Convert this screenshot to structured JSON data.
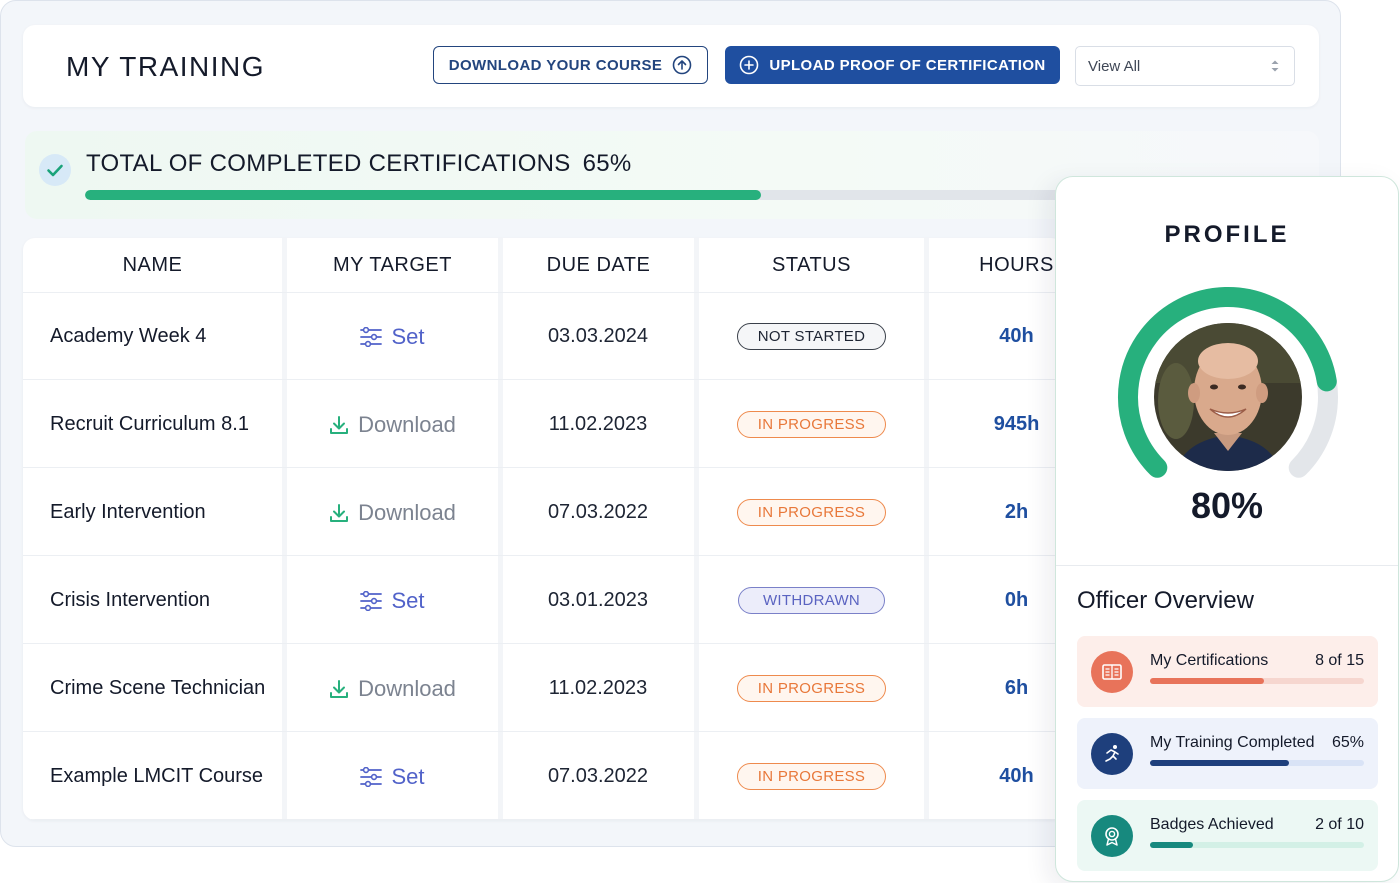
{
  "header": {
    "title": "MY TRAINING",
    "download_label": "DOWNLOAD YOUR COURSE",
    "upload_label": "UPLOAD PROOF OF CERTIFICATION",
    "filter_value": "View All"
  },
  "progress": {
    "title": "TOTAL OF COMPLETED CERTIFICATIONS",
    "percent_text": "65%",
    "percent": 65,
    "fill_color": "#27b07d"
  },
  "table": {
    "columns": [
      "NAME",
      "MY TARGET",
      "DUE DATE",
      "STATUS",
      "HOURS"
    ],
    "rows": [
      {
        "name": "Academy Week 4",
        "target": "Set",
        "target_type": "set",
        "due": "03.03.2024",
        "status": "NOT STARTED",
        "status_type": "ns",
        "hours": "40h"
      },
      {
        "name": "Recruit Curriculum 8.1",
        "target": "Download",
        "target_type": "dl",
        "due": "11.02.2023",
        "status": "IN PROGRESS",
        "status_type": "ip",
        "hours": "945h"
      },
      {
        "name": "Early Intervention",
        "target": "Download",
        "target_type": "dl",
        "due": "07.03.2022",
        "status": "IN PROGRESS",
        "status_type": "ip",
        "hours": "2h"
      },
      {
        "name": "Crisis Intervention",
        "target": "Set",
        "target_type": "set",
        "due": "03.01.2023",
        "status": "WITHDRAWN",
        "status_type": "wd",
        "hours": "0h"
      },
      {
        "name": "Crime Scene Technician",
        "target": "Download",
        "target_type": "dl",
        "due": "11.02.2023",
        "status": "IN PROGRESS",
        "status_type": "ip",
        "hours": "6h"
      },
      {
        "name": "Example LMCIT Course",
        "target": "Set",
        "target_type": "set",
        "due": "07.03.2022",
        "status": "IN PROGRESS",
        "status_type": "ip",
        "hours": "40h"
      }
    ]
  },
  "profile": {
    "title": "PROFILE",
    "percent_text": "80%",
    "percent": 80,
    "ring_color": "#27b07d",
    "overview_title": "Officer Overview",
    "stats": [
      {
        "label": "My Certifications",
        "value": "8 of 15",
        "fraction": 0.5333,
        "icon": "book-icon",
        "bg": "#fdeeea",
        "icon_bg": "#e8735a",
        "track": "#f6d6cf",
        "fill": "#e8735a"
      },
      {
        "label": "My Training Completed",
        "value": "65%",
        "fraction": 0.65,
        "icon": "runner-icon",
        "bg": "#eef2fb",
        "icon_bg": "#1e3f7c",
        "track": "#d9e3f6",
        "fill": "#1e3f7c"
      },
      {
        "label": "Badges Achieved",
        "value": "2 of 10",
        "fraction": 0.2,
        "icon": "badge-icon",
        "bg": "#ecf8f4",
        "icon_bg": "#17897e",
        "track": "#d3f0e6",
        "fill": "#17897e"
      }
    ]
  }
}
